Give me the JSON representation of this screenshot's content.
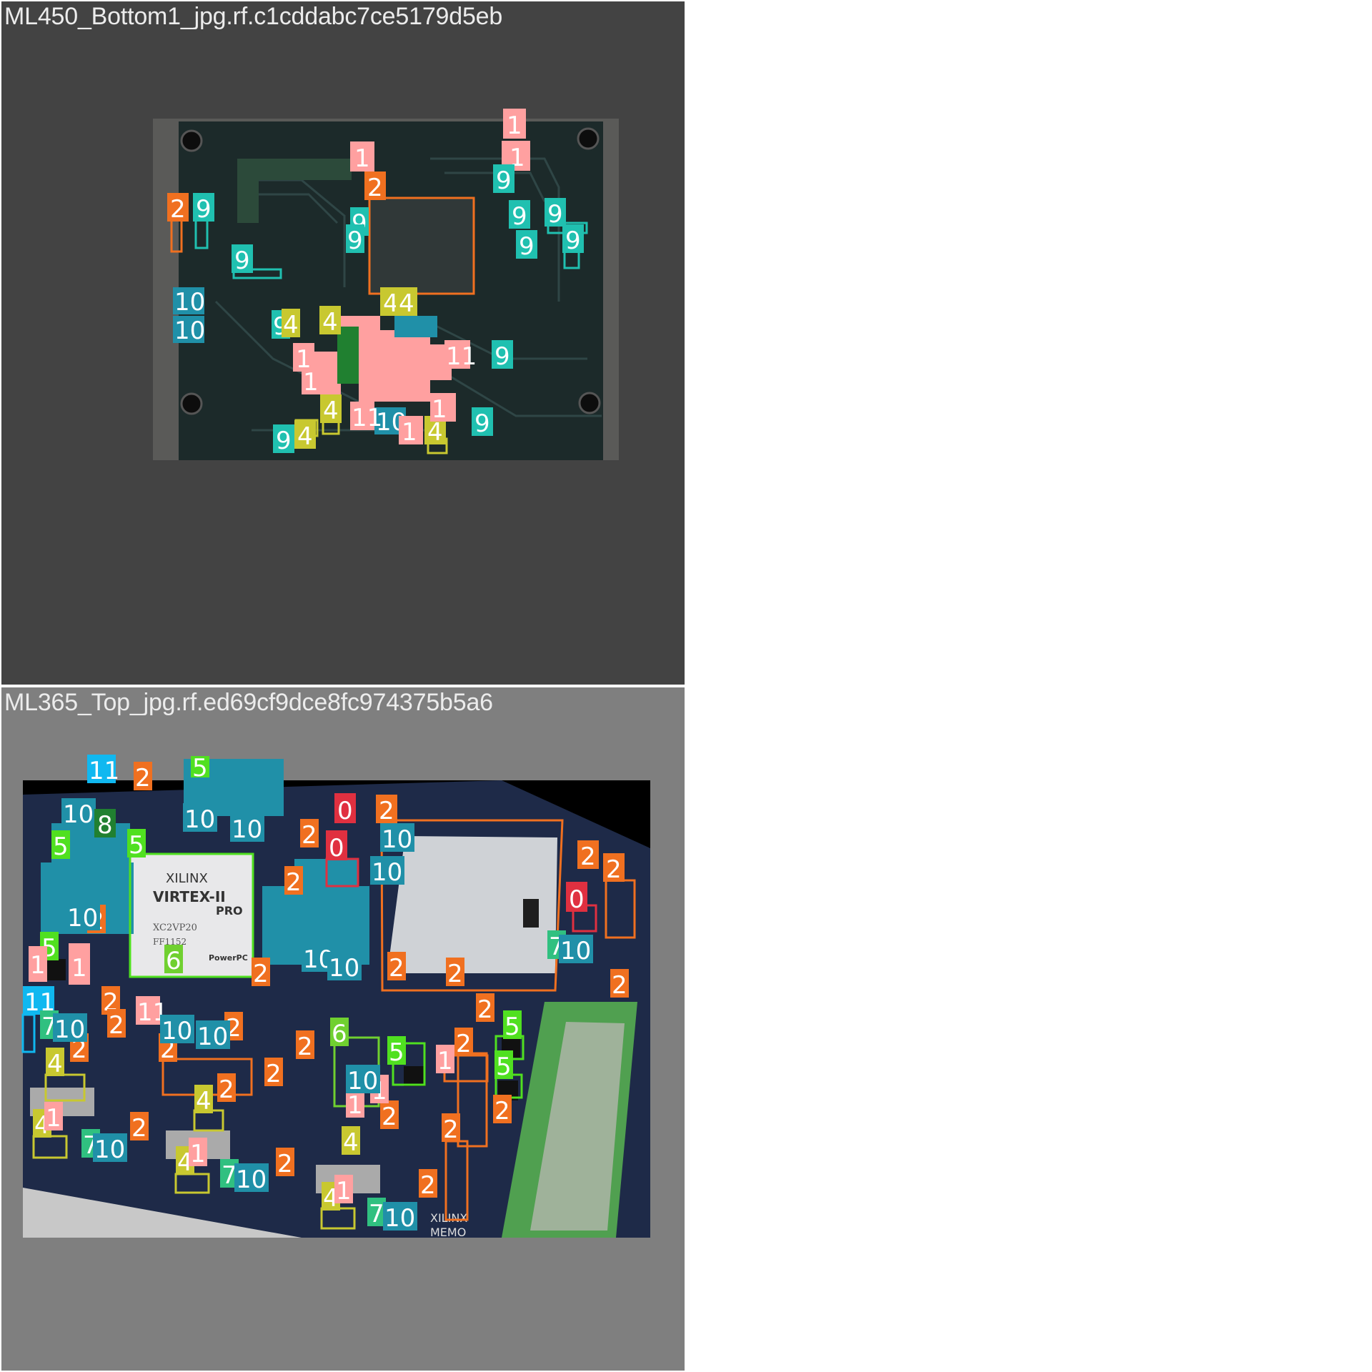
{
  "panels": [
    {
      "caption": "ML450_Bottom1_jpg.rf.c1cddabc7ce5179d5eb",
      "background": "#434343",
      "board_color": "#1c2a2a",
      "detections": [
        {
          "label": "1",
          "color": "#ffa0a0"
        },
        {
          "label": "1",
          "color": "#ffa0a0"
        },
        {
          "label": "1",
          "color": "#ffa0a0"
        },
        {
          "label": "2",
          "color": "#f07020"
        },
        {
          "label": "2",
          "color": "#f07020"
        },
        {
          "label": "9",
          "color": "#20c0b0"
        },
        {
          "label": "9",
          "color": "#20c0b0"
        },
        {
          "label": "9",
          "color": "#20c0b0"
        },
        {
          "label": "9",
          "color": "#20c0b0"
        },
        {
          "label": "9",
          "color": "#20c0b0"
        },
        {
          "label": "9",
          "color": "#20c0b0"
        },
        {
          "label": "9",
          "color": "#20c0b0"
        },
        {
          "label": "9",
          "color": "#20c0b0"
        },
        {
          "label": "9",
          "color": "#20c0b0"
        },
        {
          "label": "9",
          "color": "#20c0b0"
        },
        {
          "label": "9",
          "color": "#20c0b0"
        },
        {
          "label": "9",
          "color": "#20c0b0"
        },
        {
          "label": "10",
          "color": "#2090a8"
        },
        {
          "label": "10",
          "color": "#2090a8"
        },
        {
          "label": "10",
          "color": "#2090a8"
        },
        {
          "label": "4",
          "color": "#c8c830"
        },
        {
          "label": "4",
          "color": "#c8c830"
        },
        {
          "label": "4",
          "color": "#c8c830"
        },
        {
          "label": "4",
          "color": "#c8c830"
        },
        {
          "label": "4",
          "color": "#c8c830"
        },
        {
          "label": "4",
          "color": "#c8c830"
        },
        {
          "label": "1",
          "color": "#ffa0a0"
        },
        {
          "label": "1",
          "color": "#ffa0a0"
        },
        {
          "label": "1",
          "color": "#ffa0a0"
        },
        {
          "label": "1",
          "color": "#ffa0a0"
        },
        {
          "label": "1",
          "color": "#ffa0a0"
        },
        {
          "label": "1",
          "color": "#ffa0a0"
        },
        {
          "label": "1",
          "color": "#ffa0a0"
        },
        {
          "label": "10",
          "color": "#2090a8"
        }
      ]
    },
    {
      "caption": "ML365_Top_jpg.rf.ed69cf9dce8fc974375b5a6",
      "background": "#7f7f7f",
      "board_color": "#1e2a48",
      "chip_text": [
        "XILINX",
        "VIRTEX-II",
        "PRO",
        "XC2VP20",
        "FF1152",
        "PowerPC"
      ],
      "board_text": [
        "XILINX",
        "MEMO"
      ],
      "detections": [
        {
          "label": "11",
          "color": "#10b8f0"
        },
        {
          "label": "2",
          "color": "#f07020"
        },
        {
          "label": "5",
          "color": "#50e020"
        },
        {
          "label": "10",
          "color": "#2090a8"
        },
        {
          "label": "10",
          "color": "#2090a8"
        },
        {
          "label": "10",
          "color": "#2090a8"
        },
        {
          "label": "7",
          "color": "#30c080"
        },
        {
          "label": "8",
          "color": "#208030"
        },
        {
          "label": "0",
          "color": "#e03040"
        },
        {
          "label": "0",
          "color": "#e03040"
        },
        {
          "label": "0",
          "color": "#e03040"
        },
        {
          "label": "2",
          "color": "#f07020"
        },
        {
          "label": "2",
          "color": "#f07020"
        },
        {
          "label": "2",
          "color": "#f07020"
        },
        {
          "label": "2",
          "color": "#f07020"
        },
        {
          "label": "6",
          "color": "#70d030"
        },
        {
          "label": "6",
          "color": "#70d030"
        },
        {
          "label": "5",
          "color": "#50e020"
        },
        {
          "label": "5",
          "color": "#50e020"
        },
        {
          "label": "5",
          "color": "#50e020"
        },
        {
          "label": "4",
          "color": "#c8c830"
        },
        {
          "label": "4",
          "color": "#c8c830"
        },
        {
          "label": "4",
          "color": "#c8c830"
        },
        {
          "label": "4",
          "color": "#c8c830"
        },
        {
          "label": "1",
          "color": "#ffa0a0"
        },
        {
          "label": "1",
          "color": "#ffa0a0"
        },
        {
          "label": "11",
          "color": "#10b8f0"
        },
        {
          "label": "7",
          "color": "#30c080"
        },
        {
          "label": "10",
          "color": "#2090a8"
        },
        {
          "label": "10",
          "color": "#2090a8"
        }
      ]
    }
  ]
}
